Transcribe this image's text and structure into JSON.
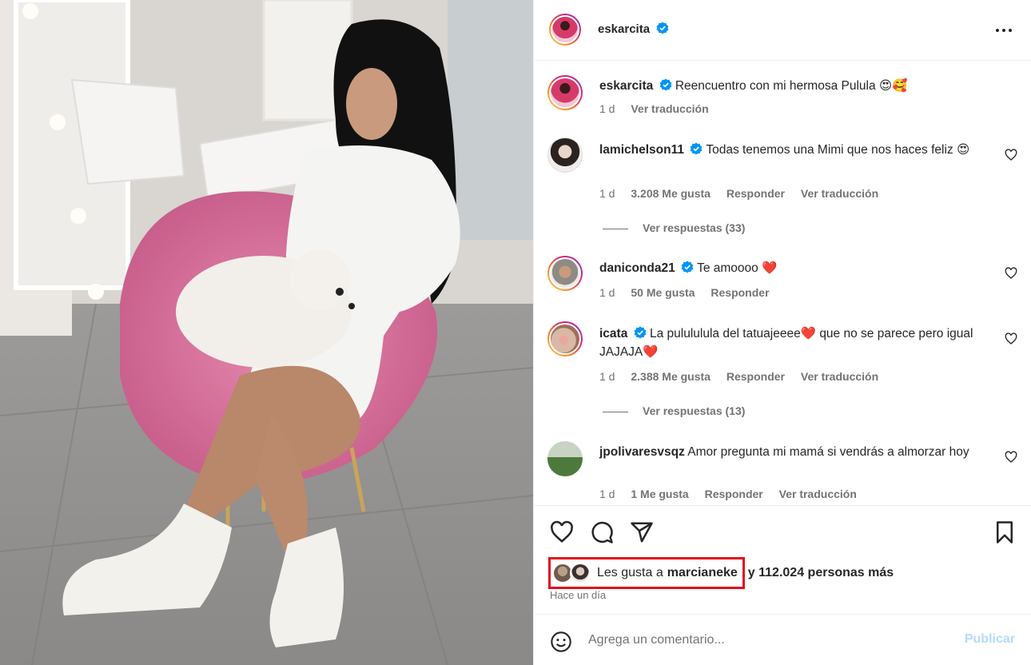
{
  "post": {
    "author": "eskarcita",
    "caption": "Reencuentro con mi hermosa Pulula 😍🥰",
    "caption_time": "1 d",
    "caption_translate": "Ver traducción"
  },
  "comments": [
    {
      "user": "lamichelson11",
      "verified": true,
      "text": "Todas tenemos una Mimi que nos haces feliz 😍",
      "time": "1 d",
      "likes": "3.208 Me gusta",
      "reply": "Responder",
      "translate": "Ver traducción",
      "replies": "Ver respuestas (33)"
    },
    {
      "user": "daniconda21",
      "verified": true,
      "text": "Te amoooo ❤️",
      "time": "1 d",
      "likes": "50 Me gusta",
      "reply": "Responder"
    },
    {
      "user": "icata",
      "verified": true,
      "text": "La pulululula del tatuajeeee❤️  que no se parece pero igual JAJAJA❤️",
      "time": "1 d",
      "likes": "2.388 Me gusta",
      "reply": "Responder",
      "translate": "Ver traducción",
      "replies": "Ver respuestas (13)"
    },
    {
      "user": "jpolivaresvsqz",
      "verified": false,
      "text": "Amor pregunta mi mamá si vendrás a almorzar hoy",
      "time": "1 d",
      "likes": "1 Me gusta",
      "reply": "Responder",
      "translate": "Ver traducción"
    }
  ],
  "likes": {
    "prefix": "Les gusta a",
    "user": "marcianeke",
    "suffix": "y 112.024 personas más"
  },
  "time_ago": "Hace un día",
  "composer": {
    "placeholder": "Agrega un comentario...",
    "publish": "Publicar"
  },
  "colors": {
    "verified": "#0095f6",
    "highlight": "#e0101e",
    "heart": "#ed4956"
  }
}
